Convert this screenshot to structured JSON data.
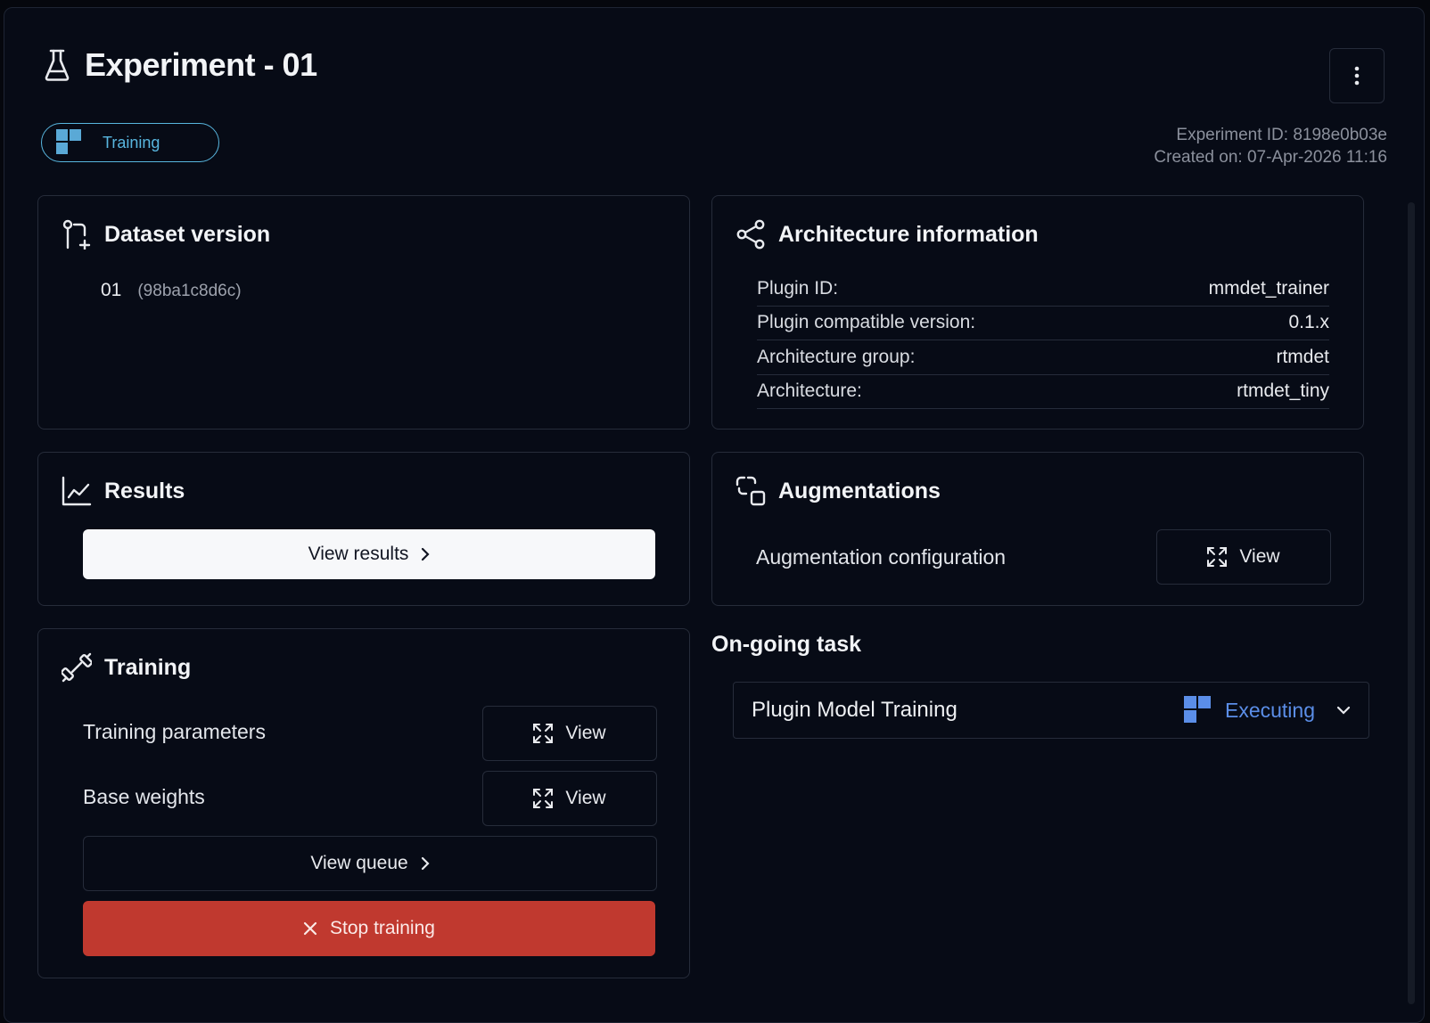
{
  "header": {
    "title": "Experiment - 01",
    "status": "Training",
    "experiment_id": "Experiment ID: 8198e0b03e",
    "created_on": "Created on: 07-Apr-2026 11:16"
  },
  "dataset": {
    "title": "Dataset version",
    "version": "01",
    "hash": "(98ba1c8d6c)"
  },
  "architecture": {
    "title": "Architecture information",
    "rows": [
      {
        "key": "Plugin ID:",
        "value": "mmdet_trainer"
      },
      {
        "key": "Plugin compatible version:",
        "value": "0.1.x"
      },
      {
        "key": "Architecture group:",
        "value": "rtmdet"
      },
      {
        "key": "Architecture:",
        "value": "rtmdet_tiny"
      }
    ]
  },
  "results": {
    "title": "Results",
    "view_results_label": "View results"
  },
  "augmentations": {
    "title": "Augmentations",
    "config_label": "Augmentation configuration",
    "view_label": "View"
  },
  "training": {
    "title": "Training",
    "params_label": "Training parameters",
    "params_view": "View",
    "weights_label": "Base weights",
    "weights_view": "View",
    "queue_label": "View queue",
    "stop_label": "Stop training"
  },
  "ongoing": {
    "title": "On-going task",
    "task_name": "Plugin Model Training",
    "task_status": "Executing"
  },
  "colors": {
    "accent_cyan": "#58b6df",
    "executing_blue": "#5b8ee8",
    "stop_red": "#c0392f"
  },
  "icons": [
    "flask-icon",
    "kebab-menu-icon",
    "status-blocks-icon",
    "git-pull-request-icon",
    "share-nodes-icon",
    "line-chart-icon",
    "augment-icon",
    "dumbbell-icon",
    "expand-icon",
    "chevron-right-icon",
    "close-icon",
    "chevron-down-icon"
  ]
}
